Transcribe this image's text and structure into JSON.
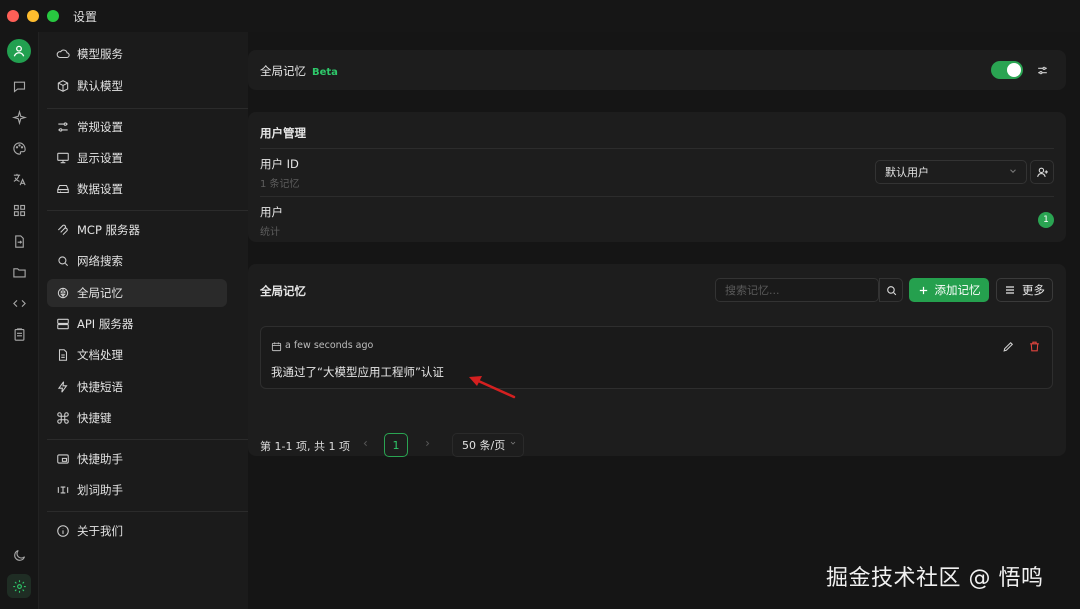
{
  "window": {
    "title": "设置"
  },
  "sidebar": {
    "items": [
      {
        "label": "模型服务"
      },
      {
        "label": "默认模型"
      },
      {
        "label": "常规设置"
      },
      {
        "label": "显示设置"
      },
      {
        "label": "数据设置"
      },
      {
        "label": "MCP 服务器"
      },
      {
        "label": "网络搜索"
      },
      {
        "label": "全局记忆"
      },
      {
        "label": "API 服务器"
      },
      {
        "label": "文档处理"
      },
      {
        "label": "快捷短语"
      },
      {
        "label": "快捷键"
      },
      {
        "label": "快捷助手"
      },
      {
        "label": "划词助手"
      },
      {
        "label": "关于我们"
      }
    ],
    "active": "全局记忆"
  },
  "global_memory_card": {
    "title": "全局记忆",
    "badge": "Beta",
    "enabled": true
  },
  "user_card": {
    "title": "用户管理",
    "user_id_label": "用户 ID",
    "user_id_sub": "1 条记忆",
    "user_select": "默认用户",
    "user_label": "用户",
    "user_sub": "统计",
    "user_count": "1"
  },
  "memory_list": {
    "title": "全局记忆",
    "search_placeholder": "搜索记忆...",
    "add_label": "添加记忆",
    "more_label": "更多",
    "items": [
      {
        "time": "a few seconds ago",
        "content": "我通过了“大模型应用工程师”认证"
      }
    ]
  },
  "pagination": {
    "summary": "第 1-1 项, 共 1 项",
    "current_page": "1",
    "page_size": "50 条/页"
  },
  "watermark": "掘金技术社区 @ 悟鸣",
  "colors": {
    "accent": "#25a04e",
    "background": "#151515",
    "card": "#1d1d1d",
    "danger": "#e0443e",
    "arrow": "#d42020"
  }
}
